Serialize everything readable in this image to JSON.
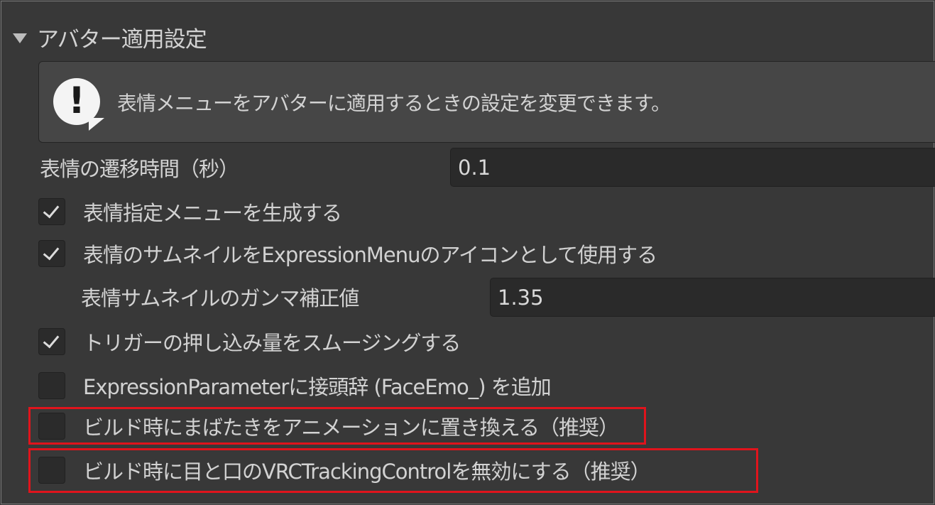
{
  "section": {
    "title": "アバター適用設定",
    "expanded": true
  },
  "help": {
    "icon": "speech-bubble-exclamation-icon",
    "text": "表情メニューをアバターに適用するときの設定を変更できます。"
  },
  "transition": {
    "label": "表情の遷移時間（秒）",
    "value": "0.1"
  },
  "options": [
    {
      "label": "表情指定メニューを生成する",
      "checked": true
    },
    {
      "label": "表情のサムネイルをExpressionMenuのアイコンとして使用する",
      "checked": true
    },
    {
      "label": "トリガーの押し込み量をスムージングする",
      "checked": true
    },
    {
      "label": "ExpressionParameterに接頭辞 (FaceEmo_) を追加",
      "checked": false
    },
    {
      "label": "ビルド時にまばたきをアニメーションに置き換える（推奨）",
      "checked": false,
      "highlighted": true
    },
    {
      "label": "ビルド時に目と口のVRCTrackingControlを無効にする（推奨）",
      "checked": false,
      "highlighted": true
    }
  ],
  "gamma": {
    "label": "表情サムネイルのガンマ補正値",
    "value": "1.35"
  },
  "colors": {
    "background": "#383838",
    "field": "#2a2a2a",
    "highlight": "#e0141c",
    "text": "#d2d2d2"
  }
}
